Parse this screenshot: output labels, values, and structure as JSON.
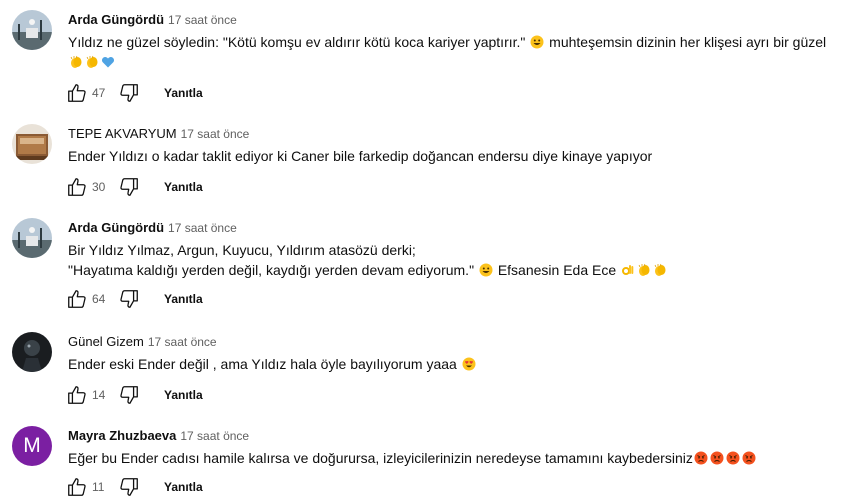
{
  "comments": [
    {
      "author": "Arda Güngördü",
      "time": "17 saat önce",
      "lines": [
        {
          "text": "Yıldız ne güzel söyledin: \"Kötü komşu ev aldırır kötü koca kariyer yaptırır.\"",
          "emojis_after": [
            "smile"
          ],
          "text2": " muhteşemsin dizinin her klişesi ayrı bir güzel"
        },
        {
          "text": "",
          "emojis_after": [
            "clap",
            "clap",
            "blue-heart"
          ],
          "text2": ""
        }
      ],
      "likes": "47",
      "reply_label": "Yanıtla"
    },
    {
      "author": "TEPE AKVARYUM",
      "time": "17 saat önce",
      "lines": [
        {
          "text": "Ender Yıldızı o kadar taklit ediyor ki Caner bile farkedip doğancan endersu diye kinaye yapıyor",
          "emojis_after": [],
          "text2": ""
        }
      ],
      "likes": "30",
      "reply_label": "Yanıtla"
    },
    {
      "author": "Arda Güngördü",
      "time": "17 saat önce",
      "lines": [
        {
          "text": "Bir Yıldız Yılmaz, Argun, Kuyucu, Yıldırım atasözü derki;",
          "emojis_after": [],
          "text2": ""
        },
        {
          "text": "\"Hayatıma kaldığı yerden değil, kaydığı yerden devam ediyorum.\"",
          "emojis_after": [
            "smile"
          ],
          "text2": " Efsanesin Eda Ece",
          "emojis_end": [
            "ok-hand",
            "clap",
            "clap"
          ]
        }
      ],
      "likes": "64",
      "reply_label": "Yanıtla"
    },
    {
      "author": "Günel Gizem",
      "time": "17 saat önce",
      "lines": [
        {
          "text": "Ender eski Ender değil ,  ama Yıldız hala öyle bayılıyorum yaaa",
          "emojis_after": [
            "heart-eyes"
          ],
          "text2": ""
        }
      ],
      "likes": "14",
      "reply_label": "Yanıtla"
    },
    {
      "author": "Mayra Zhuzbaeva",
      "avatar_letter": "M",
      "time": "17 saat önce",
      "lines": [
        {
          "text": "Eğer bu Ender cadısı hamile kalırsa ve doğurursa, izleyicilerinizin neredeyse tamamını kaybedersiniz",
          "emojis_after": [
            "angry",
            "angry",
            "angry",
            "angry"
          ],
          "text2": ""
        }
      ],
      "likes": "11",
      "reply_label": "Yanıtla"
    }
  ],
  "colors": {
    "avatar_purple": "#7b1fa2",
    "meta_gray": "#606060",
    "text": "#0f0f0f"
  },
  "icons": {
    "like": "thumbs-up-icon",
    "dislike": "thumbs-down-icon"
  }
}
